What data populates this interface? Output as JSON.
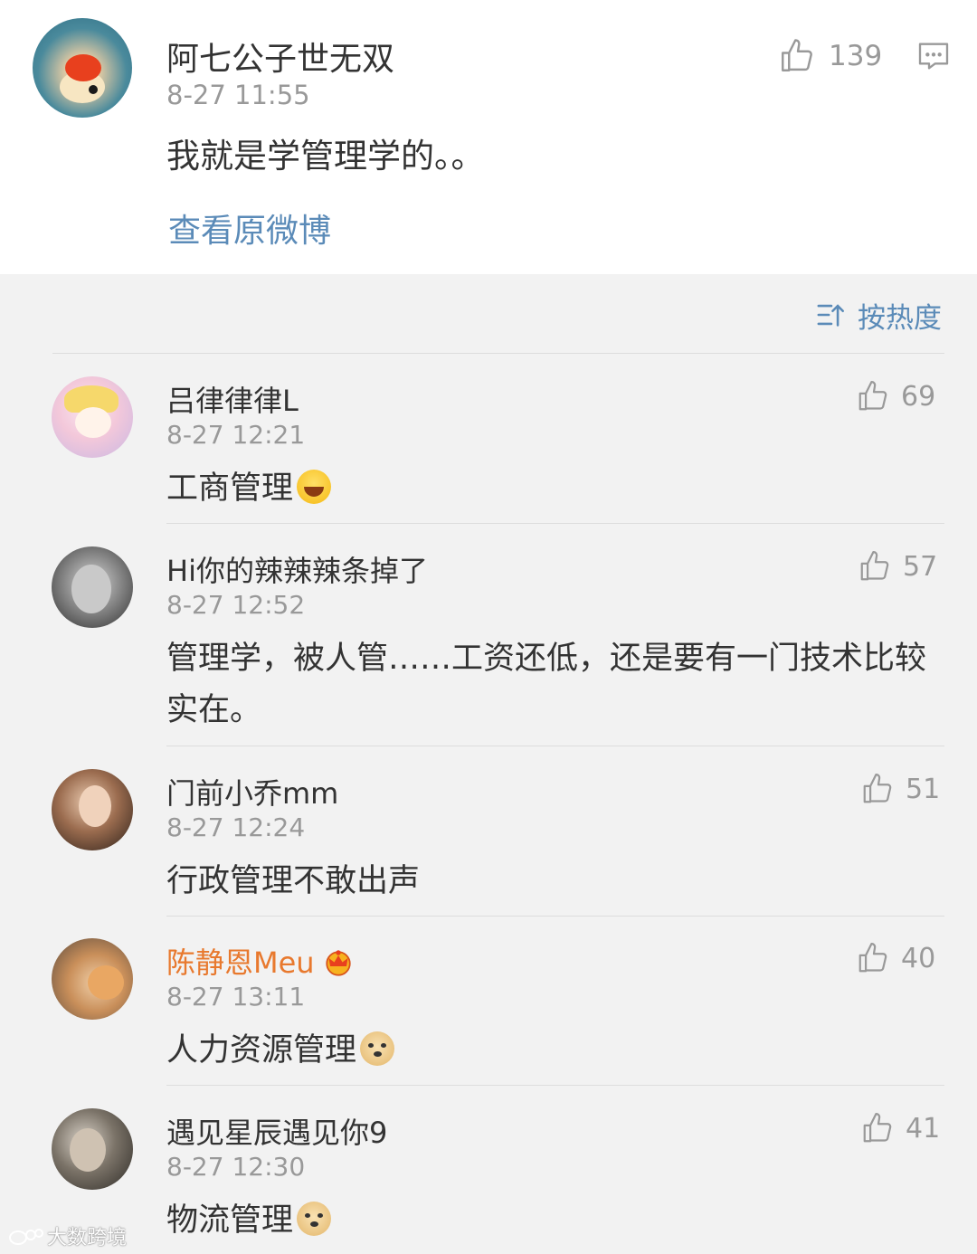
{
  "main_post": {
    "author": "阿七公子世无双",
    "time": "8-27 11:55",
    "text": "我就是学管理学的。。",
    "likes": "139",
    "view_original": "查看原微博"
  },
  "sort": {
    "label": "按热度"
  },
  "comments": [
    {
      "name": "吕律律律L",
      "time": "8-27 12:21",
      "text": "工商管理",
      "likes": "69",
      "emoji": "laughing-tears-emoji",
      "vip": false
    },
    {
      "name": "Hi你的辣辣辣条掉了",
      "time": "8-27 12:52",
      "text": "管理学，被人管……工资还低，还是要有一门技术比较实在。",
      "likes": "57",
      "vip": false
    },
    {
      "name": "门前小乔mm",
      "time": "8-27 12:24",
      "text": "行政管理不敢出声",
      "likes": "51",
      "vip": false
    },
    {
      "name": "陈静恩Meu",
      "time": "8-27 13:11",
      "text": "人力资源管理",
      "likes": "40",
      "emoji": "doge-emoji",
      "vip": true
    },
    {
      "name": "遇见星辰遇见你9",
      "time": "8-27 12:30",
      "text": "物流管理",
      "likes": "41",
      "emoji": "doge-emoji",
      "vip": false
    }
  ],
  "watermark": "大数跨境",
  "colors": {
    "link": "#5b8bb8",
    "vip_name": "#e8792e",
    "meta": "#999999",
    "background": "#f2f2f2"
  }
}
